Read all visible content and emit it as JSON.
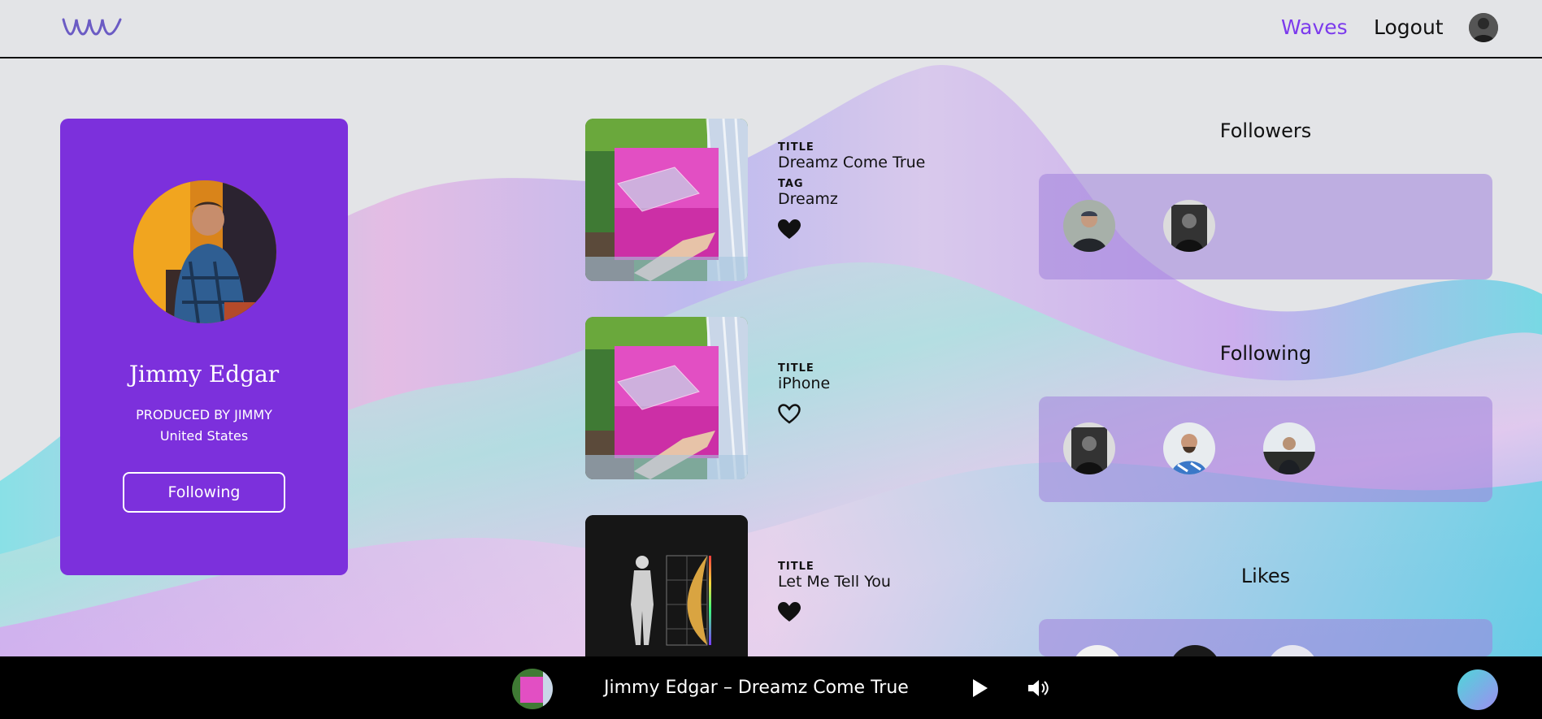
{
  "header": {
    "nav_waves": "Waves",
    "nav_logout": "Logout",
    "accent_color": "#7c3aed"
  },
  "profile": {
    "name": "Jimmy Edgar",
    "produced_by": "PRODUCED BY JIMMY",
    "country": "United States",
    "follow_button": "Following",
    "card_color": "#7c30dc"
  },
  "tracks": [
    {
      "title_label": "TITLE",
      "title": "Dreamz Come True",
      "tag_label": "TAG",
      "tag": "Dreamz",
      "liked": true,
      "art_icon": "waterfall-box-art"
    },
    {
      "title_label": "TITLE",
      "title": "iPhone",
      "liked": false,
      "art_icon": "waterfall-box-art"
    },
    {
      "title_label": "TITLE",
      "title": "Let Me Tell You",
      "liked": true,
      "art_icon": "statue-art"
    }
  ],
  "panels": {
    "followers_title": "Followers",
    "following_title": "Following",
    "likes_title": "Likes",
    "followers_count": 2,
    "following_count": 3
  },
  "player": {
    "now_playing": "Jimmy Edgar – Dreamz Come True",
    "play_icon": "play-icon",
    "volume_icon": "volume-icon"
  }
}
